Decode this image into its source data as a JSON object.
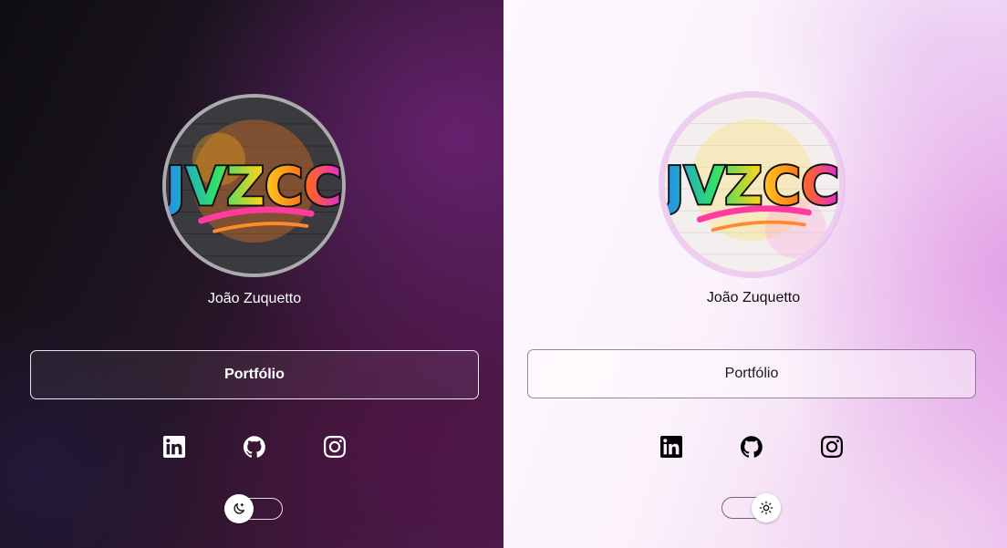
{
  "profile": {
    "name": "João Zuquetto",
    "logo_text": "JVZCC"
  },
  "links": {
    "portfolio_label": "Portfólio"
  },
  "social": [
    {
      "name": "linkedin",
      "icon": "linkedin-icon"
    },
    {
      "name": "github",
      "icon": "github-icon"
    },
    {
      "name": "instagram",
      "icon": "instagram-icon"
    }
  ],
  "theme_toggle": {
    "dark_state": "moon-icon",
    "light_state": "sun-icon"
  },
  "colors": {
    "dark_bg": "#1d1420",
    "dark_accent": "#4d1c4d",
    "light_bg": "#fbf2fb",
    "light_accent": "#e6b5ec"
  }
}
